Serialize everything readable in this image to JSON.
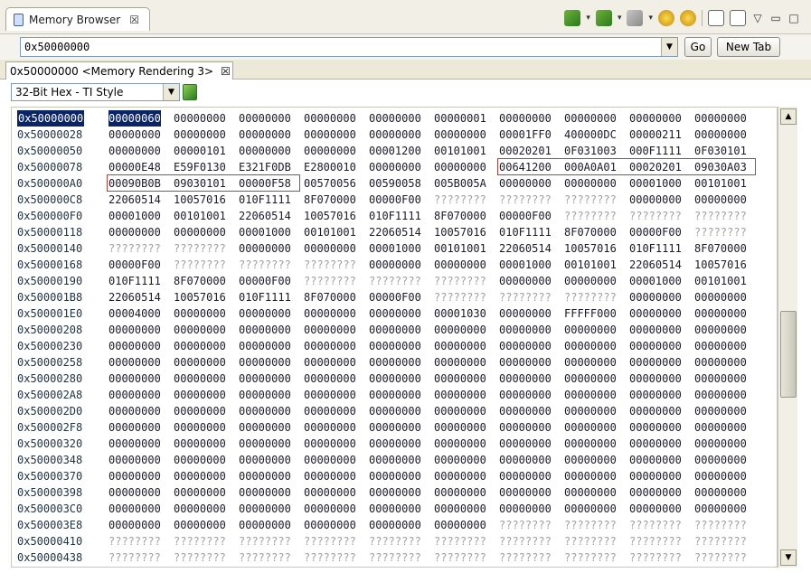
{
  "view_tab": {
    "title": "Memory Browser",
    "close": "☒"
  },
  "toolbar": {
    "dropdown": "▾",
    "view_menu": "▽",
    "minimize": "▭",
    "maximize": "□"
  },
  "address_bar": {
    "value": "0x50000000",
    "combo_arrow": "▼",
    "go_label": "Go",
    "new_tab_label": "New Tab"
  },
  "rendering_tab": {
    "title": "0x50000000 <Memory Rendering 3>",
    "close": "☒"
  },
  "format": {
    "value": "32-Bit Hex - TI Style",
    "combo_arrow": "▼"
  },
  "scrollbar": {
    "up": "▲",
    "down": "▼",
    "position": 0.55
  },
  "memory": {
    "rows": [
      {
        "address": "0x50000000",
        "cells": [
          "00000060",
          "00000000",
          "00000000",
          "00000000",
          "00000000",
          "00000001",
          "00000000",
          "00000000",
          "00000000",
          "00000000"
        ]
      },
      {
        "address": "0x50000028",
        "cells": [
          "00000000",
          "00000000",
          "00000000",
          "00000000",
          "00000000",
          "00000000",
          "00001FF0",
          "400000DC",
          "00000211",
          "00000000"
        ]
      },
      {
        "address": "0x50000050",
        "cells": [
          "00000000",
          "00000101",
          "00000000",
          "00000000",
          "00001200",
          "00101001",
          "00020201",
          "0F031003",
          "000F1111",
          "0F030101"
        ]
      },
      {
        "address": "0x50000078",
        "cells": [
          "00000E48",
          "E59F0130",
          "E321F0DB",
          "E2800010",
          "00000000",
          "00000000",
          "00641200",
          "000A0A01",
          "00020201",
          "09030A03"
        ]
      },
      {
        "address": "0x500000A0",
        "cells": [
          "00090B0B",
          "09030101",
          "00000F58",
          "00570056",
          "00590058",
          "005B005A",
          "00000000",
          "00000000",
          "00001000",
          "00101001"
        ]
      },
      {
        "address": "0x500000C8",
        "cells": [
          "22060514",
          "10057016",
          "010F1111",
          "8F070000",
          "00000F00",
          "????????",
          "????????",
          "????????",
          "00000000",
          "00000000"
        ]
      },
      {
        "address": "0x500000F0",
        "cells": [
          "00001000",
          "00101001",
          "22060514",
          "10057016",
          "010F1111",
          "8F070000",
          "00000F00",
          "????????",
          "????????",
          "????????"
        ]
      },
      {
        "address": "0x50000118",
        "cells": [
          "00000000",
          "00000000",
          "00001000",
          "00101001",
          "22060514",
          "10057016",
          "010F1111",
          "8F070000",
          "00000F00",
          "????????"
        ]
      },
      {
        "address": "0x50000140",
        "cells": [
          "????????",
          "????????",
          "00000000",
          "00000000",
          "00001000",
          "00101001",
          "22060514",
          "10057016",
          "010F1111",
          "8F070000"
        ]
      },
      {
        "address": "0x50000168",
        "cells": [
          "00000F00",
          "????????",
          "????????",
          "????????",
          "00000000",
          "00000000",
          "00001000",
          "00101001",
          "22060514",
          "10057016"
        ]
      },
      {
        "address": "0x50000190",
        "cells": [
          "010F1111",
          "8F070000",
          "00000F00",
          "????????",
          "????????",
          "????????",
          "00000000",
          "00000000",
          "00001000",
          "00101001"
        ]
      },
      {
        "address": "0x500001B8",
        "cells": [
          "22060514",
          "10057016",
          "010F1111",
          "8F070000",
          "00000F00",
          "????????",
          "????????",
          "????????",
          "00000000",
          "00000000"
        ]
      },
      {
        "address": "0x500001E0",
        "cells": [
          "00004000",
          "00000000",
          "00000000",
          "00000000",
          "00000000",
          "00001030",
          "00000000",
          "FFFFF000",
          "00000000",
          "00000000"
        ]
      },
      {
        "address": "0x50000208",
        "cells": [
          "00000000",
          "00000000",
          "00000000",
          "00000000",
          "00000000",
          "00000000",
          "00000000",
          "00000000",
          "00000000",
          "00000000"
        ]
      },
      {
        "address": "0x50000230",
        "cells": [
          "00000000",
          "00000000",
          "00000000",
          "00000000",
          "00000000",
          "00000000",
          "00000000",
          "00000000",
          "00000000",
          "00000000"
        ]
      },
      {
        "address": "0x50000258",
        "cells": [
          "00000000",
          "00000000",
          "00000000",
          "00000000",
          "00000000",
          "00000000",
          "00000000",
          "00000000",
          "00000000",
          "00000000"
        ]
      },
      {
        "address": "0x50000280",
        "cells": [
          "00000000",
          "00000000",
          "00000000",
          "00000000",
          "00000000",
          "00000000",
          "00000000",
          "00000000",
          "00000000",
          "00000000"
        ]
      },
      {
        "address": "0x500002A8",
        "cells": [
          "00000000",
          "00000000",
          "00000000",
          "00000000",
          "00000000",
          "00000000",
          "00000000",
          "00000000",
          "00000000",
          "00000000"
        ]
      },
      {
        "address": "0x500002D0",
        "cells": [
          "00000000",
          "00000000",
          "00000000",
          "00000000",
          "00000000",
          "00000000",
          "00000000",
          "00000000",
          "00000000",
          "00000000"
        ]
      },
      {
        "address": "0x500002F8",
        "cells": [
          "00000000",
          "00000000",
          "00000000",
          "00000000",
          "00000000",
          "00000000",
          "00000000",
          "00000000",
          "00000000",
          "00000000"
        ]
      },
      {
        "address": "0x50000320",
        "cells": [
          "00000000",
          "00000000",
          "00000000",
          "00000000",
          "00000000",
          "00000000",
          "00000000",
          "00000000",
          "00000000",
          "00000000"
        ]
      },
      {
        "address": "0x50000348",
        "cells": [
          "00000000",
          "00000000",
          "00000000",
          "00000000",
          "00000000",
          "00000000",
          "00000000",
          "00000000",
          "00000000",
          "00000000"
        ]
      },
      {
        "address": "0x50000370",
        "cells": [
          "00000000",
          "00000000",
          "00000000",
          "00000000",
          "00000000",
          "00000000",
          "00000000",
          "00000000",
          "00000000",
          "00000000"
        ]
      },
      {
        "address": "0x50000398",
        "cells": [
          "00000000",
          "00000000",
          "00000000",
          "00000000",
          "00000000",
          "00000000",
          "00000000",
          "00000000",
          "00000000",
          "00000000"
        ]
      },
      {
        "address": "0x500003C0",
        "cells": [
          "00000000",
          "00000000",
          "00000000",
          "00000000",
          "00000000",
          "00000000",
          "00000000",
          "00000000",
          "00000000",
          "00000000"
        ]
      },
      {
        "address": "0x500003E8",
        "cells": [
          "00000000",
          "00000000",
          "00000000",
          "00000000",
          "00000000",
          "00000000",
          "????????",
          "????????",
          "????????",
          "????????"
        ]
      },
      {
        "address": "0x50000410",
        "cells": [
          "????????",
          "????????",
          "????????",
          "????????",
          "????????",
          "????????",
          "????????",
          "????????",
          "????????",
          "????????"
        ]
      },
      {
        "address": "0x50000438",
        "cells": [
          "????????",
          "????????",
          "????????",
          "????????",
          "????????",
          "????????",
          "????????",
          "????????",
          "????????",
          "????????"
        ]
      }
    ]
  }
}
